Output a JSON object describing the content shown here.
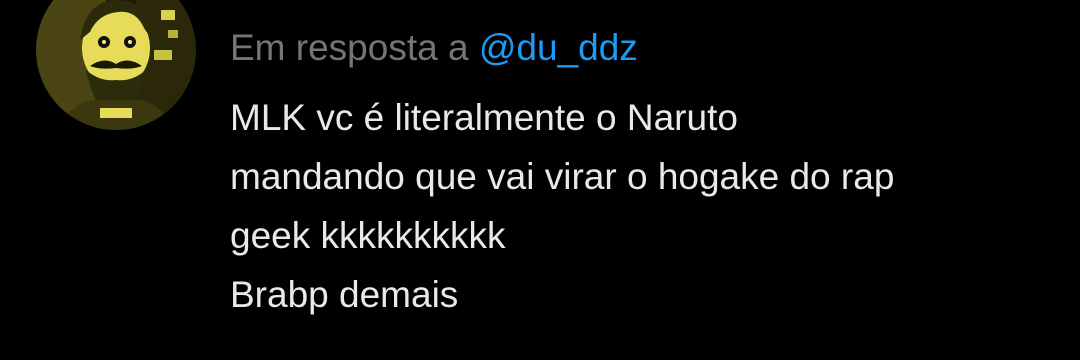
{
  "reply": {
    "prefix": "Em resposta a",
    "mention": "@du_ddz"
  },
  "tweet": {
    "lines": [
      "MLK vc é literalmente o Naruto",
      "mandando que vai virar o hogake do rap",
      "geek kkkkkkkkkk",
      "Brabp demais"
    ]
  },
  "colors": {
    "background": "#000000",
    "text": "#e7e9ea",
    "secondary_text": "#71767b",
    "mention": "#1d9bf0"
  },
  "icons": {
    "avatar": "user-avatar-bearded-yellow-illustration"
  }
}
